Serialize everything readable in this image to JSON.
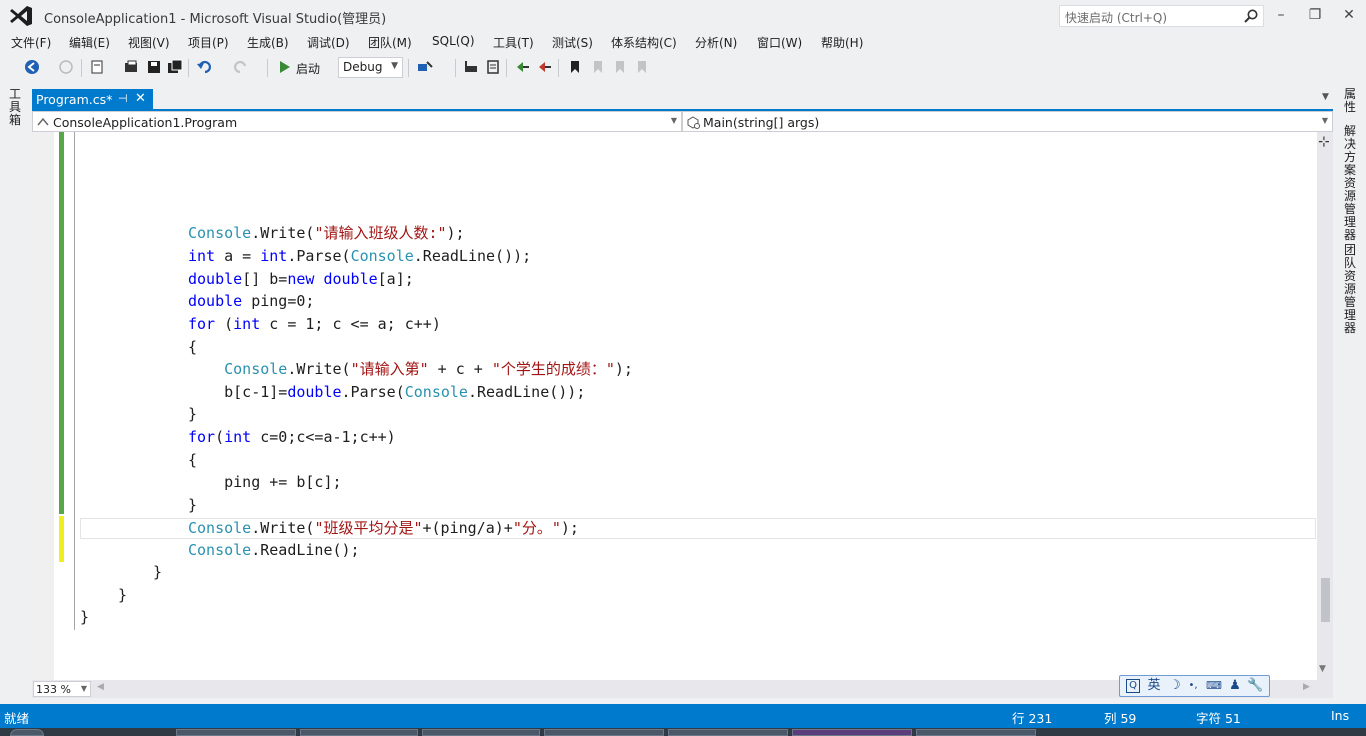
{
  "window": {
    "title": "ConsoleApplication1 - Microsoft Visual Studio(管理员)",
    "quick_launch_placeholder": "快速启动 (Ctrl+Q)",
    "minimize": "–",
    "maximize": "❐",
    "close": "✕"
  },
  "menu": [
    "文件(F)",
    "编辑(E)",
    "视图(V)",
    "项目(P)",
    "生成(B)",
    "调试(D)",
    "团队(M)",
    "SQL(Q)",
    "工具(T)",
    "测试(S)",
    "体系结构(C)",
    "分析(N)",
    "窗口(W)",
    "帮助(H)"
  ],
  "toolbar": {
    "start_label": "启动",
    "config": "Debug"
  },
  "left_panel": {
    "toolbox_label": "工具箱"
  },
  "right_panel": {
    "tabs": [
      "属性",
      "解决方案资源管理器",
      "团队资源管理器"
    ]
  },
  "document_tab": {
    "label": "Program.cs*",
    "pin": "⊣",
    "close": "✕"
  },
  "navbar": {
    "class_path": "ConsoleApplication1.Program",
    "member": "Main(string[] args)"
  },
  "code": [
    [
      {
        "c": "t",
        "v": "Console"
      },
      {
        "c": "p",
        "v": ".Write("
      },
      {
        "c": "s",
        "v": "\"请输入班级人数:\""
      },
      {
        "c": "p",
        "v": ");"
      }
    ],
    [
      {
        "c": "k",
        "v": "int"
      },
      {
        "c": "p",
        "v": " a = "
      },
      {
        "c": "k",
        "v": "int"
      },
      {
        "c": "p",
        "v": ".Parse("
      },
      {
        "c": "t",
        "v": "Console"
      },
      {
        "c": "p",
        "v": ".ReadLine());"
      }
    ],
    [
      {
        "c": "k",
        "v": "double"
      },
      {
        "c": "p",
        "v": "[] b="
      },
      {
        "c": "k",
        "v": "new"
      },
      {
        "c": "p",
        "v": " "
      },
      {
        "c": "k",
        "v": "double"
      },
      {
        "c": "p",
        "v": "[a];"
      }
    ],
    [
      {
        "c": "k",
        "v": "double"
      },
      {
        "c": "p",
        "v": " ping=0;"
      }
    ],
    [
      {
        "c": "k",
        "v": "for"
      },
      {
        "c": "p",
        "v": " ("
      },
      {
        "c": "k",
        "v": "int"
      },
      {
        "c": "p",
        "v": " c = 1; c <= a; c++)"
      }
    ],
    [
      {
        "c": "p",
        "v": "{"
      }
    ],
    [
      {
        "c": "p",
        "v": "    "
      },
      {
        "c": "t",
        "v": "Console"
      },
      {
        "c": "p",
        "v": ".Write("
      },
      {
        "c": "s",
        "v": "\"请输入第\""
      },
      {
        "c": "p",
        "v": " + c + "
      },
      {
        "c": "s",
        "v": "\"个学生的成绩：\""
      },
      {
        "c": "p",
        "v": ");"
      }
    ],
    [
      {
        "c": "p",
        "v": "    b[c-1]="
      },
      {
        "c": "k",
        "v": "double"
      },
      {
        "c": "p",
        "v": ".Parse("
      },
      {
        "c": "t",
        "v": "Console"
      },
      {
        "c": "p",
        "v": ".ReadLine());"
      }
    ],
    [
      {
        "c": "p",
        "v": "}"
      }
    ],
    [
      {
        "c": "k",
        "v": "for"
      },
      {
        "c": "p",
        "v": "("
      },
      {
        "c": "k",
        "v": "int"
      },
      {
        "c": "p",
        "v": " c=0;c<=a-1;c++)"
      }
    ],
    [
      {
        "c": "p",
        "v": "{"
      }
    ],
    [
      {
        "c": "p",
        "v": "    ping += b[c];"
      }
    ],
    [
      {
        "c": "p",
        "v": "}"
      }
    ],
    [
      {
        "c": "t",
        "v": "Console"
      },
      {
        "c": "p",
        "v": ".Write("
      },
      {
        "c": "s",
        "v": "\"班级平均分是\""
      },
      {
        "c": "p",
        "v": "+(ping/a)+"
      },
      {
        "c": "s",
        "v": "\"分。\""
      },
      {
        "c": "p",
        "v": ");"
      }
    ],
    [
      {
        "c": "t",
        "v": "Console"
      },
      {
        "c": "p",
        "v": ".ReadLine();"
      }
    ],
    [
      {
        "c": "p",
        "v": "}"
      }
    ],
    [
      {
        "c": "p",
        "v": "}"
      }
    ],
    [
      {
        "c": "p",
        "v": "}"
      }
    ]
  ],
  "zoom": "133 %",
  "ime": {
    "lang": "英"
  },
  "status": {
    "ready": "就绪",
    "line": "行 231",
    "col": "列 59",
    "char": "字符 51",
    "mode": "Ins"
  }
}
